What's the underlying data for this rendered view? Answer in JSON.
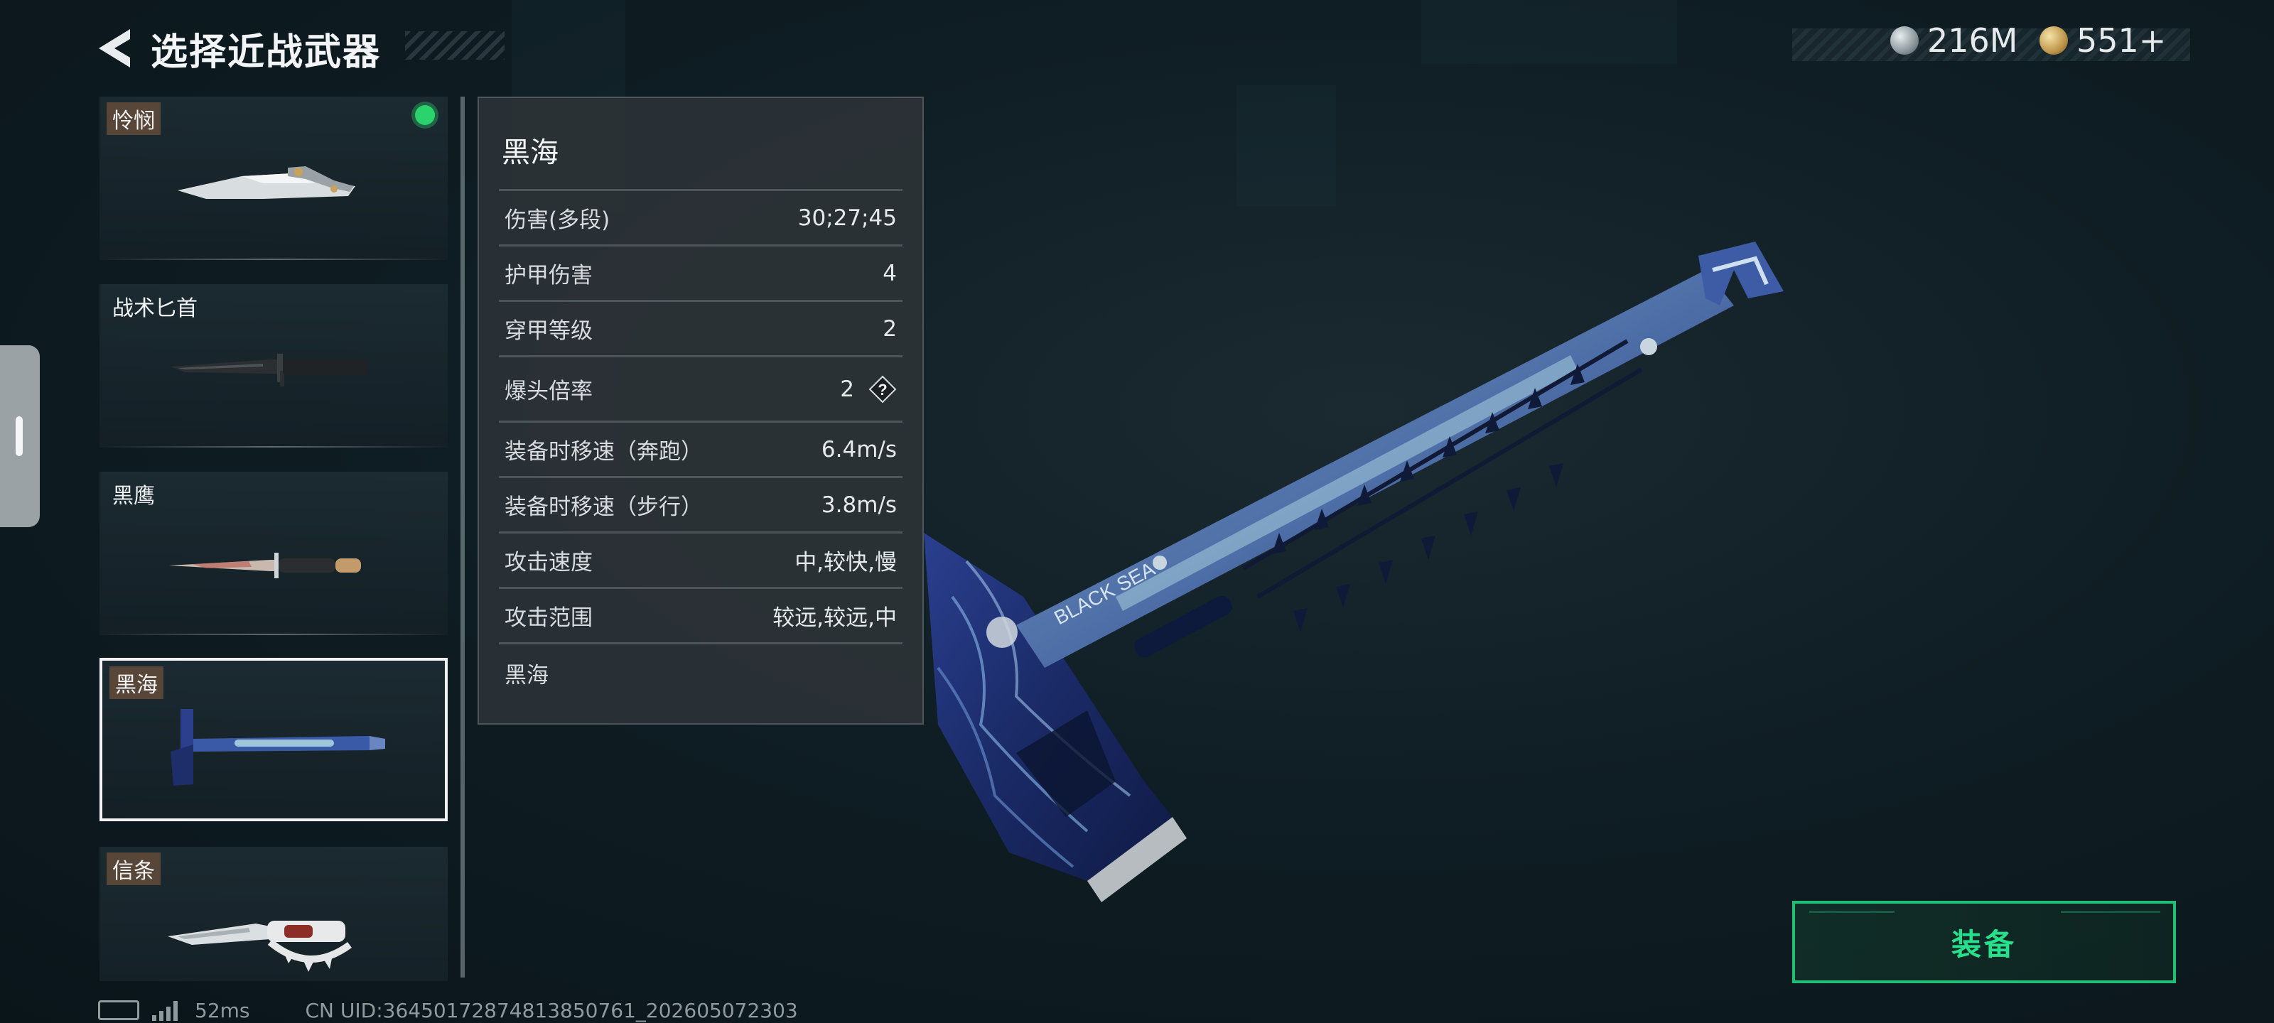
{
  "header": {
    "title": "选择近战武器"
  },
  "currency": [
    {
      "icon": "silver-coin-icon",
      "amount": "216M"
    },
    {
      "icon": "gold-coin-icon",
      "amount": "551+"
    }
  ],
  "weapons": [
    {
      "name": "怜悯",
      "equipped": true,
      "selected": false
    },
    {
      "name": "战术匕首",
      "equipped": false,
      "selected": false
    },
    {
      "name": "黑鹰",
      "equipped": false,
      "selected": false
    },
    {
      "name": "黑海",
      "equipped": false,
      "selected": true
    },
    {
      "name": "信条",
      "equipped": false,
      "selected": false
    }
  ],
  "stats": {
    "weapon_name": "黑海",
    "rows": [
      {
        "label": "伤害(多段)",
        "value": "30;27;45"
      },
      {
        "label": "护甲伤害",
        "value": "4"
      },
      {
        "label": "穿甲等级",
        "value": "2"
      },
      {
        "label": "爆头倍率",
        "value": "2",
        "help": "?"
      },
      {
        "label": "装备时移速（奔跑）",
        "value": "6.4m/s"
      },
      {
        "label": "装备时移速（步行）",
        "value": "3.8m/s"
      },
      {
        "label": "攻击速度",
        "value": "中,较快,慢"
      },
      {
        "label": "攻击范围",
        "value": "较远,较远,中"
      }
    ],
    "footer": "黑海"
  },
  "showcase": {
    "engraving": "BLACK SEA"
  },
  "equip_button": {
    "label": "装备"
  },
  "status": {
    "ping": "52ms",
    "uid": "CN UID:36450172874813850761_202605072303"
  },
  "colors": {
    "accent_green": "#27e08c",
    "equipped_dot": "#2bd36c",
    "panel_bg": "#2c3236"
  }
}
